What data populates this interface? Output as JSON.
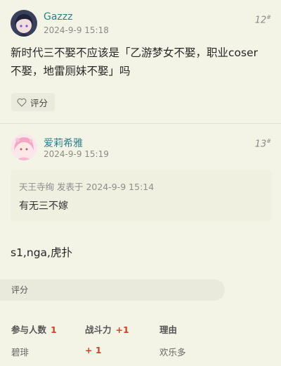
{
  "posts": [
    {
      "username": "Gazzz",
      "time": "2024-9-9 15:18",
      "floor": "12",
      "floor_suffix": "#",
      "content_lines": [
        "新时代三不娶不应该是「乙游梦女不娶，职业coser",
        "不娶，地雷厕妹不娶」吗"
      ],
      "rate_label": "评分",
      "avatar_icon": "anime-avatar-dark-hair"
    },
    {
      "username": "爱莉希雅",
      "time": "2024-9-9 15:19",
      "floor": "13",
      "floor_suffix": "#",
      "quote_head": "天王寺绚 发表于 2024-9-9 15:14",
      "quote_text": "有无三不嫁",
      "content": "s1,nga,虎扑",
      "rate_label": "评分",
      "avatar_icon": "anime-avatar-pink-hair"
    }
  ],
  "rating_table": {
    "headers": [
      "参与人数",
      "战斗力",
      "理由"
    ],
    "header_values": [
      "1",
      "+1",
      ""
    ],
    "rows": [
      {
        "user": "碧琲",
        "score": "+ 1",
        "reason": "欢乐多"
      }
    ]
  },
  "colors": {
    "background": "#f3f4e6",
    "username": "#2d7f8a",
    "accent_red": "#c8442a"
  }
}
